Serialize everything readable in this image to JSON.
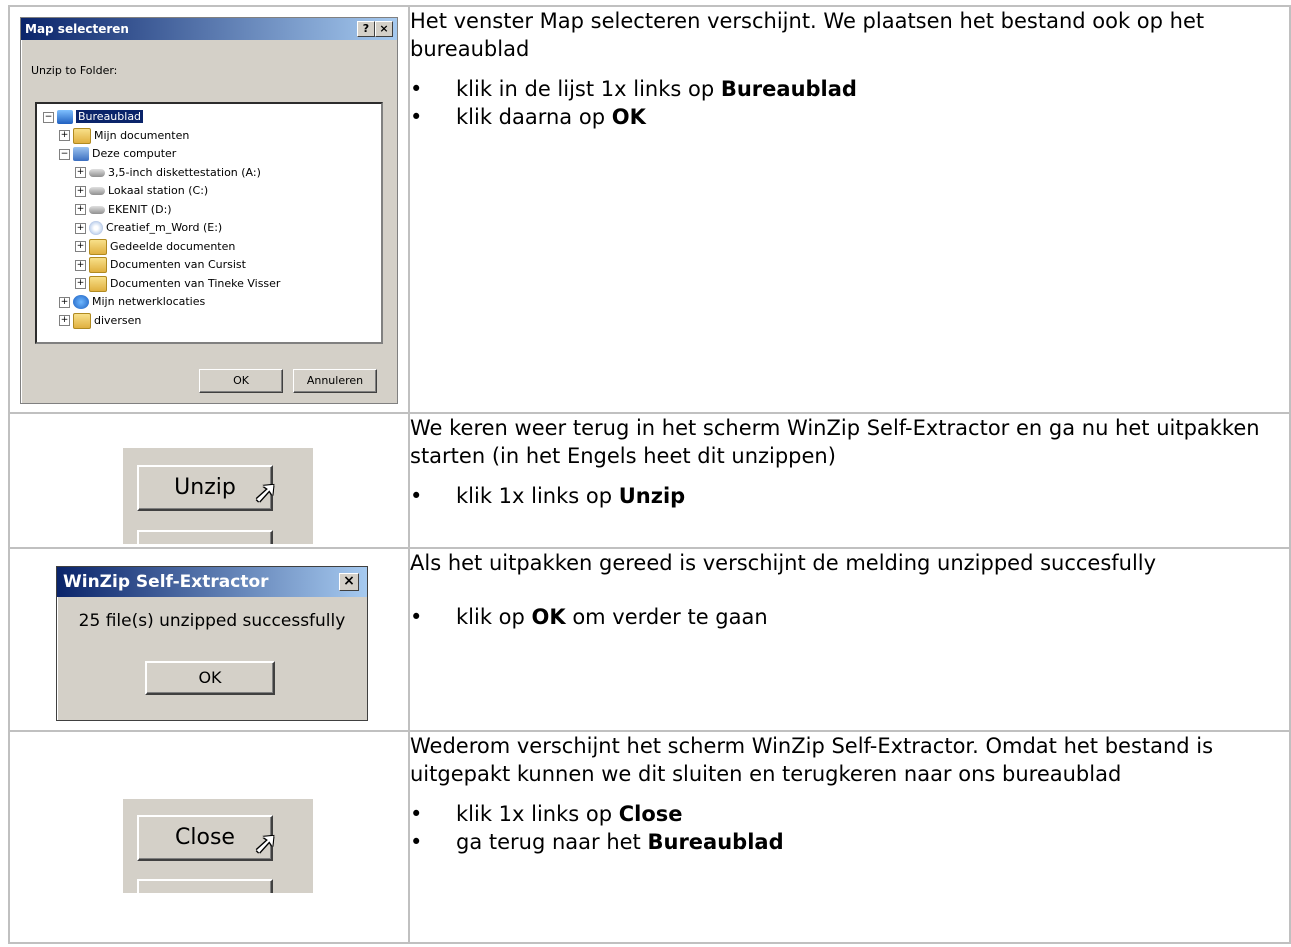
{
  "map_dialog": {
    "title": "Map selecteren",
    "help_btn": "?",
    "close_btn": "×",
    "label": "Unzip to Folder:",
    "tree": [
      {
        "text": "Bureaublad",
        "icon": "desktop-icon",
        "level": 0,
        "pm": "−",
        "selected": true
      },
      {
        "text": "Mijn documenten",
        "icon": "folder-icon",
        "level": 1,
        "pm": "+"
      },
      {
        "text": "Deze computer",
        "icon": "computer-icon",
        "level": 1,
        "pm": "−"
      },
      {
        "text": "3,5-inch diskettestation (A:)",
        "icon": "floppy-icon",
        "level": 2,
        "pm": "+"
      },
      {
        "text": "Lokaal station (C:)",
        "icon": "drive-icon",
        "level": 2,
        "pm": "+"
      },
      {
        "text": "EKENIT (D:)",
        "icon": "drive-icon",
        "level": 2,
        "pm": "+"
      },
      {
        "text": "Creatief_m_Word (E:)",
        "icon": "cd-icon",
        "level": 2,
        "pm": "+"
      },
      {
        "text": "Gedeelde documenten",
        "icon": "folder-icon",
        "level": 2,
        "pm": "+"
      },
      {
        "text": "Documenten van Cursist",
        "icon": "folder-icon",
        "level": 2,
        "pm": "+"
      },
      {
        "text": "Documenten van Tineke Visser",
        "icon": "folder-icon",
        "level": 2,
        "pm": "+"
      },
      {
        "text": "Mijn netwerklocaties",
        "icon": "network-icon",
        "level": 1,
        "pm": "+"
      },
      {
        "text": "diversen",
        "icon": "folder-icon",
        "level": 1,
        "pm": "+"
      }
    ],
    "ok": "OK",
    "cancel": "Annuleren"
  },
  "unzip_button": "Unzip",
  "winzip_dialog": {
    "title": "WinZip Self-Extractor",
    "close_btn": "×",
    "message": "25 file(s) unzipped successfully",
    "ok": "OK"
  },
  "close_button": "Close",
  "rows": [
    {
      "para": "Het venster Map selecteren verschijnt. We plaatsen het bestand ook op het bureaublad",
      "bullets": [
        {
          "pre": "klik in de lijst 1x links op ",
          "bold": "Bureaublad",
          "post": ""
        },
        {
          "pre": "klik daarna op ",
          "bold": "OK",
          "post": ""
        }
      ]
    },
    {
      "para": "We keren weer terug in het scherm WinZip Self-Extractor en ga nu het uitpakken starten (in het Engels heet dit unzippen)",
      "bullets": [
        {
          "pre": "klik 1x links op ",
          "bold": "Unzip",
          "post": ""
        }
      ]
    },
    {
      "para": "Als het uitpakken gereed is verschijnt de melding unzipped succesfully",
      "bullets": [
        {
          "pre": "klik op ",
          "bold": "OK",
          "post": " om verder te gaan"
        }
      ]
    },
    {
      "para": "Wederom verschijnt het scherm WinZip Self-Extractor. Omdat het bestand is uitgepakt kunnen we dit sluiten en terugkeren naar ons bureaublad",
      "bullets": [
        {
          "pre": "klik 1x links op ",
          "bold": "Close",
          "post": ""
        },
        {
          "pre": "ga terug naar het ",
          "bold": "Bureaublad",
          "post": ""
        }
      ]
    }
  ]
}
